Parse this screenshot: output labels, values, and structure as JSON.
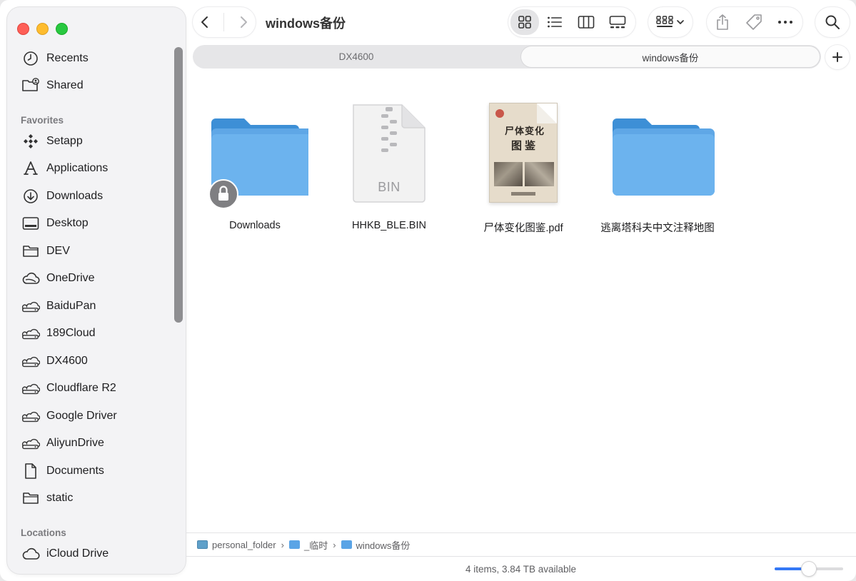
{
  "window": {
    "title": "windows备份",
    "traffic_colors": [
      "#fe5f57",
      "#febc2e",
      "#28c840"
    ]
  },
  "sidebar": {
    "items_top": [
      {
        "label": "Recents",
        "icon": "clock-icon"
      },
      {
        "label": "Shared",
        "icon": "shared-folder-icon"
      }
    ],
    "favorites_label": "Favorites",
    "favorites": [
      {
        "label": "Setapp",
        "icon": "setapp-icon"
      },
      {
        "label": "Applications",
        "icon": "applications-icon"
      },
      {
        "label": "Downloads",
        "icon": "download-circle-icon"
      },
      {
        "label": "Desktop",
        "icon": "desktop-icon"
      },
      {
        "label": "DEV",
        "icon": "folder-icon"
      },
      {
        "label": "OneDrive",
        "icon": "cloud-icon"
      },
      {
        "label": "BaiduPan",
        "icon": "cloud-drive-icon"
      },
      {
        "label": "189Cloud",
        "icon": "cloud-drive-icon"
      },
      {
        "label": "DX4600",
        "icon": "cloud-drive-icon"
      },
      {
        "label": "Cloudflare R2",
        "icon": "cloud-drive-icon"
      },
      {
        "label": "Google Driver",
        "icon": "cloud-drive-icon"
      },
      {
        "label": "AliyunDrive",
        "icon": "cloud-drive-icon"
      },
      {
        "label": "Documents",
        "icon": "document-icon"
      },
      {
        "label": "static",
        "icon": "folder-icon"
      }
    ],
    "locations_label": "Locations",
    "locations": [
      {
        "label": "iCloud Drive",
        "icon": "cloud-icon"
      }
    ]
  },
  "toolbar": {
    "view_modes": [
      "icon-view",
      "list-view",
      "column-view",
      "gallery-view"
    ],
    "active_view": "icon-view"
  },
  "tabs": [
    {
      "label": "DX4600",
      "active": false
    },
    {
      "label": "windows备份",
      "active": true
    }
  ],
  "files": [
    {
      "name": "Downloads",
      "kind": "folder-locked"
    },
    {
      "name": "HHKB_BLE.BIN",
      "kind": "bin",
      "badge": "BIN"
    },
    {
      "name": "尸体变化图鉴.pdf",
      "kind": "pdf",
      "cover_title_1": "尸体变化",
      "cover_title_2": "图鉴"
    },
    {
      "name": "逃离塔科夫中文注释地图",
      "kind": "folder"
    }
  ],
  "pathbar": {
    "crumbs": [
      "personal_folder",
      "_临时",
      "windows备份"
    ]
  },
  "status": {
    "text": "4 items, 3.84 TB available",
    "icon_size_fraction": 0.5
  }
}
